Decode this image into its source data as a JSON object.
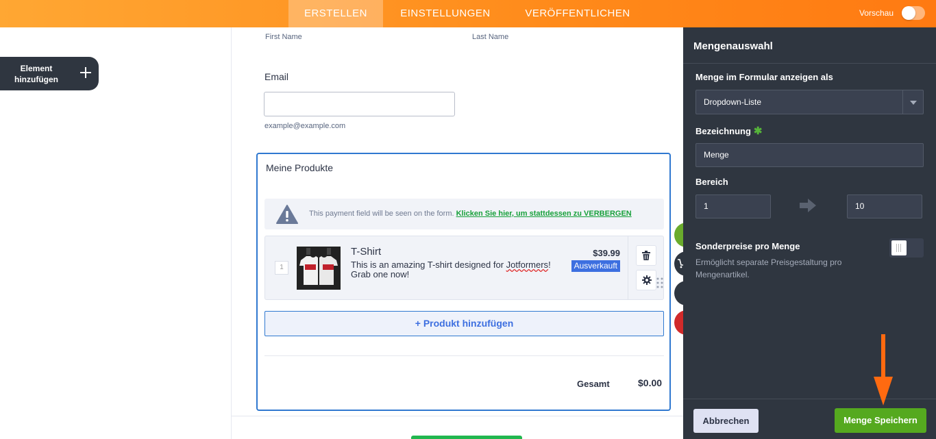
{
  "topbar": {
    "tabs": [
      "ERSTELLEN",
      "EINSTELLUNGEN",
      "VERÖFFENTLICHEN"
    ],
    "active_tab": "ERSTELLEN",
    "preview_label": "Vorschau",
    "preview_on": false
  },
  "left": {
    "add_element_label": "Element hinzufügen"
  },
  "form": {
    "first_name_sub": "First Name",
    "last_name_sub": "Last Name",
    "email_label": "Email",
    "email_hint": "example@example.com",
    "products": {
      "title": "Meine Produkte",
      "notice_text": "This payment field will be seen on the form.",
      "notice_link": "Klicken Sie hier, um stattdessen zu VERBERGEN",
      "items": [
        {
          "qty": "1",
          "name": "T-Shirt",
          "desc_pre": "This is an amazing T-shirt designed for ",
          "desc_sq": "Jotformers",
          "desc_post": "! Grab one now!",
          "price": "$39.99",
          "badge": "Ausverkauft"
        }
      ],
      "add_product_label": "+ Produkt hinzufügen",
      "total_label": "Gesamt",
      "total_value": "$0.00"
    }
  },
  "panel": {
    "title": "Mengenauswahl",
    "show_as_label": "Menge im Formular anzeigen als",
    "show_as_value": "Dropdown-Liste",
    "label_label": "Bezeichnung",
    "required_mark": "✱",
    "label_value": "Menge",
    "range_label": "Bereich",
    "range_min": "1",
    "range_max": "10",
    "special_label": "Sonderpreise pro Menge",
    "special_desc": "Ermöglicht separate Preisgestaltung pro Mengenartikel.",
    "special_on": false,
    "cancel_label": "Abbrechen",
    "save_label": "Menge Speichern"
  },
  "colors": {
    "accent_orange": "#ff8a1a",
    "panel_bg": "#2f3640",
    "save_green": "#55a91f",
    "link_green": "#17a03a",
    "blue": "#2f78d0"
  }
}
